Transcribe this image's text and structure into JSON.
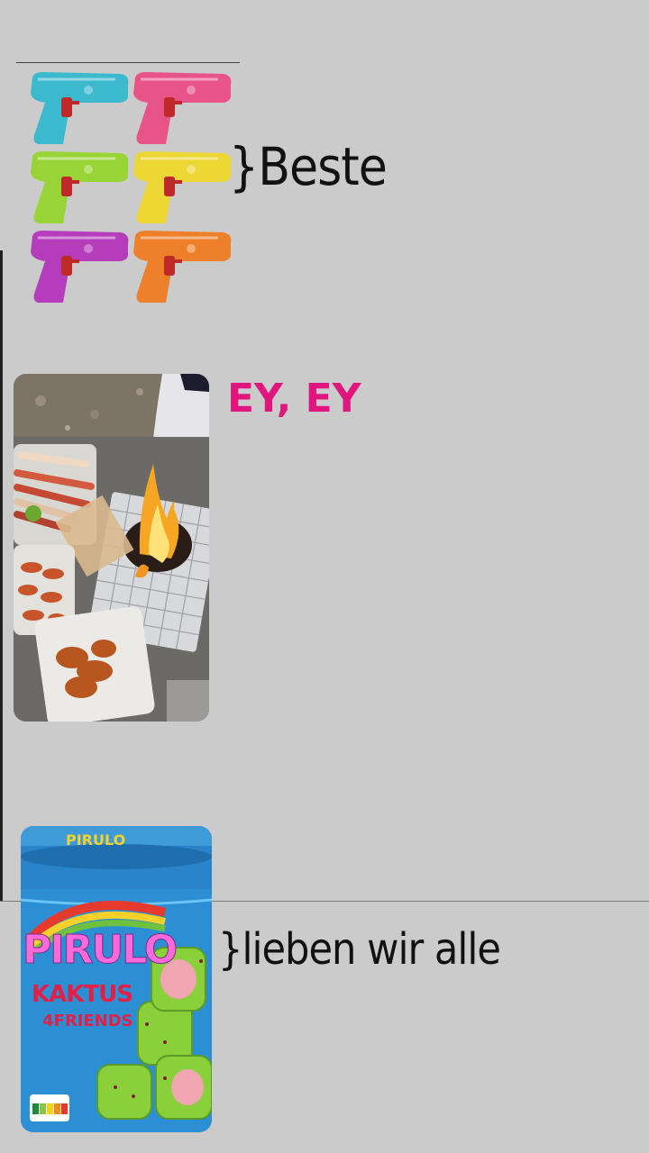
{
  "captions": {
    "beste": "}Beste",
    "ey": "EY, EY",
    "lieben": "}lieben wir alle"
  },
  "images": {
    "water_guns": [
      "teal",
      "pink",
      "green",
      "yellow",
      "purple",
      "orange"
    ],
    "gun_colors": {
      "teal": "#25b6cf",
      "pink": "#ee3f7d",
      "green": "#8fd61b",
      "yellow": "#f2d91b",
      "purple": "#b124b8",
      "orange": "#f5730f"
    },
    "product": {
      "brand": "PIRULO",
      "variant": "KAKTUS",
      "sub": "4FRIENDS"
    }
  },
  "colors": {
    "background": "#cbcbcb",
    "accent": "#e0157d"
  }
}
